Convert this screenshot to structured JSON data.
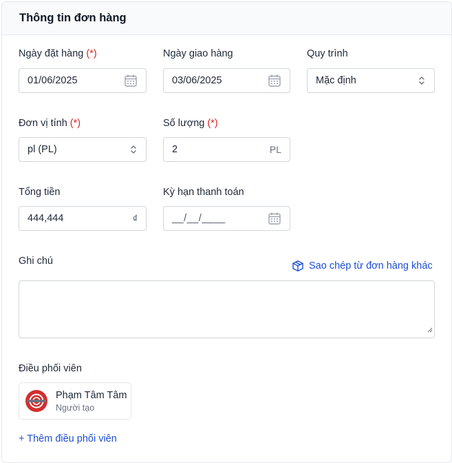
{
  "card": {
    "title": "Thông tin đơn hàng"
  },
  "fields": {
    "order_date": {
      "label": "Ngày đặt hàng",
      "required_mark": "(*)",
      "value": "01/06/2025"
    },
    "delivery_date": {
      "label": "Ngày giao hàng",
      "value": "03/06/2025"
    },
    "process": {
      "label": "Quy trình",
      "value": "Mặc định"
    },
    "unit": {
      "label": "Đơn vị tính",
      "required_mark": "(*)",
      "value": "pl (PL)"
    },
    "quantity": {
      "label": "Số lượng",
      "required_mark": "(*)",
      "value": "2",
      "suffix": "PL"
    },
    "total": {
      "label": "Tổng tiền",
      "value": "444,444",
      "suffix": "₫"
    },
    "payment_term": {
      "label": "Kỳ hạn thanh toán",
      "placeholder": "__/__/____"
    },
    "note": {
      "label": "Ghi chú",
      "value": ""
    }
  },
  "copy_link": {
    "label": "Sao chép từ đơn hàng khác",
    "icon": "box-icon"
  },
  "coordinators": {
    "label": "Điều phối viên",
    "items": [
      {
        "name": "Phạm Tâm Tâm",
        "role": "Người tạo",
        "avatar_color": "#d32f2f"
      }
    ],
    "add_label": "+ Thêm điều phối viên"
  },
  "colors": {
    "accent": "#1d4ed8",
    "required": "#dc2626",
    "border": "#d1d5db"
  }
}
